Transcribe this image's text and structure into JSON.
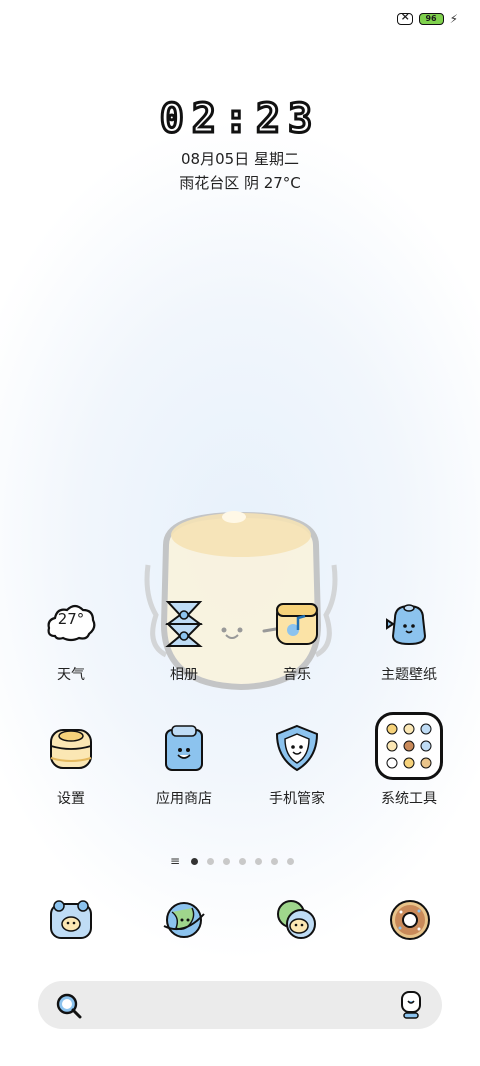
{
  "status": {
    "battery": "96"
  },
  "clock": {
    "time": "02:23"
  },
  "date": {
    "text": "08月05日 星期二"
  },
  "weather": {
    "line": "雨花台区 阴 27°C",
    "icon_value": "27°"
  },
  "apps_row1": [
    {
      "label": "天气"
    },
    {
      "label": "相册"
    },
    {
      "label": "音乐"
    },
    {
      "label": "主题壁纸"
    }
  ],
  "apps_row2": [
    {
      "label": "设置"
    },
    {
      "label": "应用商店"
    },
    {
      "label": "手机管家"
    },
    {
      "label": "系统工具"
    }
  ],
  "pages": {
    "count": 8,
    "active": 0
  },
  "dock": [
    "phone-icon",
    "browser-icon",
    "messages-icon",
    "camera-icon"
  ],
  "colors": {
    "accent_blue": "#8cc3ee",
    "cream": "#fbf2d6",
    "outline": "#1a1a1a"
  }
}
